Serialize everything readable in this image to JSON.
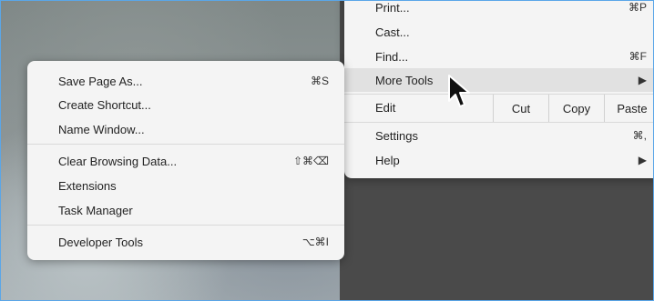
{
  "left_menu": {
    "items": [
      {
        "label": "Save Page As...",
        "shortcut": "⌘S"
      },
      {
        "label": "Create Shortcut...",
        "shortcut": ""
      },
      {
        "label": "Name Window...",
        "shortcut": ""
      },
      {
        "label": "Clear Browsing Data...",
        "shortcut": "⇧⌘⌫"
      },
      {
        "label": "Extensions",
        "shortcut": ""
      },
      {
        "label": "Task Manager",
        "shortcut": ""
      },
      {
        "label": "Developer Tools",
        "shortcut": "⌥⌘I"
      }
    ]
  },
  "right_menu": {
    "print": {
      "label": "Print...",
      "shortcut": "⌘P"
    },
    "cast": {
      "label": "Cast..."
    },
    "find": {
      "label": "Find...",
      "shortcut": "⌘F"
    },
    "more_tools": {
      "label": "More Tools",
      "arrow": "▶"
    },
    "edit": {
      "label": "Edit",
      "cut": "Cut",
      "copy": "Copy",
      "paste": "Paste"
    },
    "settings": {
      "label": "Settings",
      "shortcut": "⌘,"
    },
    "help": {
      "label": "Help",
      "arrow": "▶"
    }
  }
}
